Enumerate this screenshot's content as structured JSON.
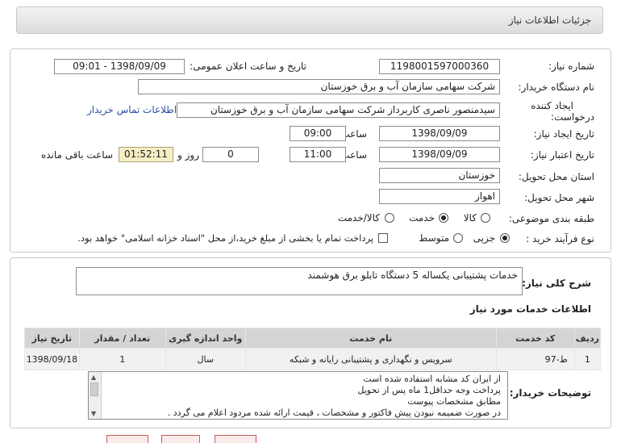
{
  "header": {
    "title": "جزئیات اطلاعات نیاز"
  },
  "need_number": {
    "label": "شماره نیاز:",
    "value": "1198001597000360"
  },
  "announce": {
    "label": "تاریخ و ساعت اعلان عمومی:",
    "value": "1398/09/09 - 09:01"
  },
  "buyer": {
    "label": "نام دستگاه خریدار:",
    "value": "شرکت سهامی سازمان آب و برق خوزستان"
  },
  "creator": {
    "label_line1": "ایجاد کننده",
    "label_line2": "درخواست:",
    "value": "سیدمنصور ناصری کاربرداز شرکت سهامی سازمان آب و برق خوزستان",
    "contact_link": "اطلاعات تماس خریدار"
  },
  "created": {
    "label": "تاریخ ایجاد نیاز:",
    "date": "1398/09/09",
    "time_label": "ساعت",
    "time": "09:00"
  },
  "validity": {
    "label": "تاریخ اعتبار نیاز:",
    "date": "1398/09/09",
    "time_label": "ساعت",
    "time": "11:00",
    "days": "0",
    "days_label": "روز و",
    "remaining": "01:52:11",
    "remaining_label": "ساعت باقی مانده"
  },
  "province": {
    "label": "استان محل تحویل:",
    "value": "خوزستان"
  },
  "city": {
    "label": "شهر محل تحویل:",
    "value": "اهواز"
  },
  "category": {
    "label": "طبقه بندی موضوعی:",
    "options": [
      "کالا",
      "خدمت",
      "کالا/خدمت"
    ],
    "selected": "خدمت"
  },
  "purchase": {
    "label": "نوع فرآیند خرید :",
    "options": [
      "جزیی",
      "متوسط"
    ],
    "selected": "جزیی",
    "check_text": "پرداخت تمام یا بخشی از مبلغ خرید،از محل \"اسناد خزانه اسلامی\" خواهد بود."
  },
  "summary": {
    "label": "شرح کلی نیاز:",
    "value": "خدمات پشتیبانی یکساله 5 دستگاه تابلو برق هوشمند"
  },
  "services": {
    "title": "اطلاعات خدمات مورد نیاز",
    "columns": [
      "ردیف",
      "کد خدمت",
      "نام خدمت",
      "واحد اندازه گیری",
      "تعداد / مقدار",
      "تاریخ نیاز"
    ],
    "rows": [
      {
        "row": "1",
        "code": "ط-97",
        "name": "سرویس و نگهداری و پشتیبانی رایانه و شبکه",
        "unit": "سال",
        "qty": "1",
        "date": "1398/09/18"
      }
    ]
  },
  "notes": {
    "label": "توضیحات خریدار:",
    "lines": [
      "از ایران کد مشابه استفاده شده است",
      "پرداخت وجه حداقل1 ماه پس از تحویل",
      "مطابق مشخصات پیوست",
      "در صورت ضمیمه نبودن پیش فاکتور و مشخصات ، قیمت ارائه شده مردود اعلام می گردد ."
    ]
  }
}
